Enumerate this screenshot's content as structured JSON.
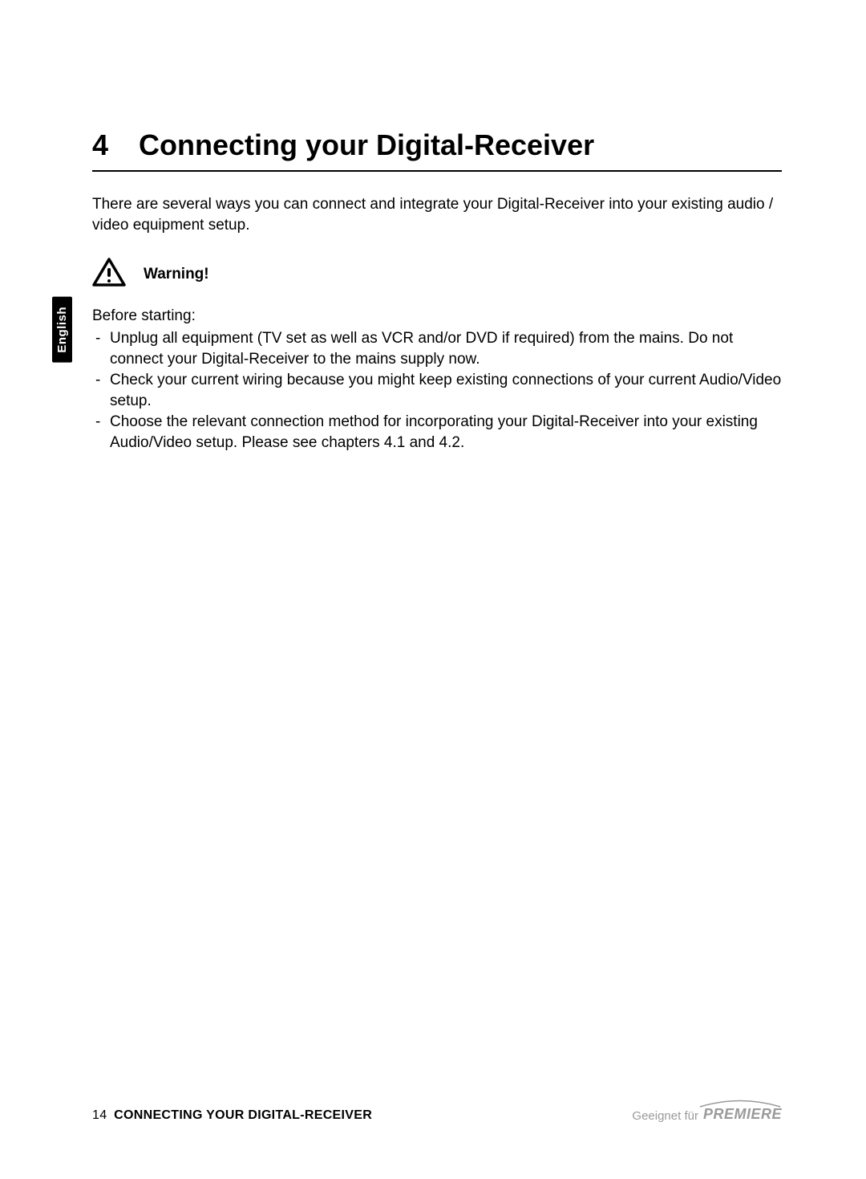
{
  "chapter": {
    "number": "4",
    "title": "Connecting your Digital-Receiver"
  },
  "intro": "There are several ways you can connect and integrate your Digital-Receiver into your existing audio / video equipment setup.",
  "warning_label": "Warning!",
  "before_starting": "Before starting:",
  "bullets": [
    "Unplug all equipment (TV set as well as VCR and/or DVD if required) from the mains. Do not connect your Digital-Receiver to the mains supply now.",
    "Check your current wiring because you might keep existing connections of your current Audio/Video setup.",
    "Choose the relevant connection method for incorporating your Digital-Receiver into your existing Audio/Video setup. Please see chapters 4.1 and 4.2."
  ],
  "side_tab": "English",
  "footer": {
    "page_number": "14",
    "section": "CONNECTING YOUR DIGITAL-RECEIVER",
    "suitable_for": "Geeignet für",
    "brand": "PREMIERE"
  }
}
